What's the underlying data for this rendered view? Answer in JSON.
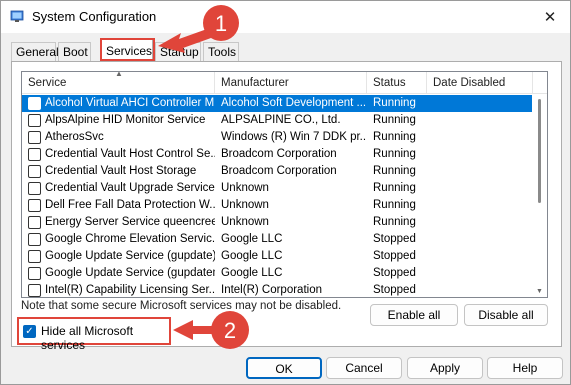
{
  "window": {
    "title": "System Configuration",
    "close_glyph": "✕"
  },
  "tabs": [
    {
      "label": "General"
    },
    {
      "label": "Boot"
    },
    {
      "label": "Services"
    },
    {
      "label": "Startup"
    },
    {
      "label": "Tools"
    }
  ],
  "columns": [
    "Service",
    "Manufacturer",
    "Status",
    "Date Disabled"
  ],
  "services": [
    {
      "name": "Alcohol Virtual AHCI Controller M...",
      "manufacturer": "Alcohol Soft Development ...",
      "status": "Running",
      "selected": true
    },
    {
      "name": "AlpsAlpine HID Monitor Service",
      "manufacturer": "ALPSALPINE CO., Ltd.",
      "status": "Running"
    },
    {
      "name": "AtherosSvc",
      "manufacturer": "Windows (R) Win 7 DDK pr...",
      "status": "Running"
    },
    {
      "name": "Credential Vault Host Control Se...",
      "manufacturer": "Broadcom Corporation",
      "status": "Running"
    },
    {
      "name": "Credential Vault Host Storage",
      "manufacturer": "Broadcom Corporation",
      "status": "Running"
    },
    {
      "name": "Credential Vault Upgrade Service",
      "manufacturer": "Unknown",
      "status": "Running"
    },
    {
      "name": "Dell Free Fall Data Protection W...",
      "manufacturer": "Unknown",
      "status": "Running"
    },
    {
      "name": "Energy Server Service queencreek",
      "manufacturer": "Unknown",
      "status": "Running"
    },
    {
      "name": "Google Chrome Elevation Servic...",
      "manufacturer": "Google LLC",
      "status": "Stopped"
    },
    {
      "name": "Google Update Service (gupdate)",
      "manufacturer": "Google LLC",
      "status": "Stopped"
    },
    {
      "name": "Google Update Service (gupdatem)",
      "manufacturer": "Google LLC",
      "status": "Stopped"
    },
    {
      "name": "Intel(R) Capability Licensing Ser...",
      "manufacturer": "Intel(R) Corporation",
      "status": "Stopped"
    }
  ],
  "note": "Note that some secure Microsoft services may not be disabled.",
  "buttons": {
    "enable_all": "Enable all",
    "disable_all": "Disable all",
    "ok": "OK",
    "cancel": "Cancel",
    "apply": "Apply",
    "help": "Help"
  },
  "hide_ms": {
    "label": "Hide all Microsoft services",
    "checked": true
  },
  "callouts": {
    "one": "1",
    "two": "2"
  },
  "colors": {
    "accent": "#0078d7",
    "callout": "#e0453a"
  }
}
